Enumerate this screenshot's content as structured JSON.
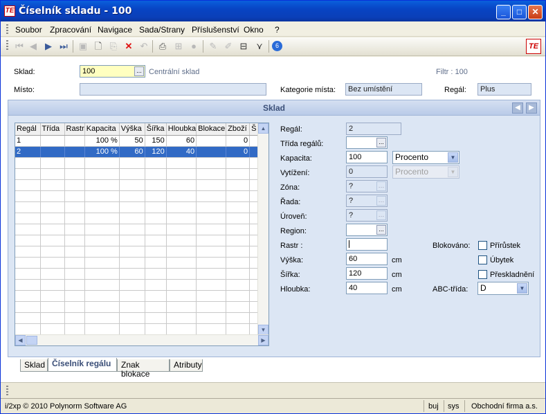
{
  "window": {
    "title": "Číselník skladu - 100",
    "app_logo": "TE"
  },
  "menu": [
    "Soubor",
    "Zpracování",
    "Navigace",
    "Sada/Strany",
    "Příslušenství",
    "Okno",
    "?"
  ],
  "toolbar": {
    "icons": [
      "first-icon",
      "prev-icon",
      "next-icon",
      "last-icon",
      "save-icon",
      "new-icon",
      "copy-icon",
      "delete-icon",
      "undo-icon",
      "print-icon",
      "tree-icon",
      "stop-icon",
      "edit-icon",
      "edit2-icon",
      "export-icon",
      "filter-icon",
      "info-icon"
    ],
    "logo": "TE"
  },
  "header": {
    "sklad_label": "Sklad:",
    "sklad_value": "100",
    "sklad_name": "Centrální sklad",
    "filtr": "Filtr : 100",
    "misto_label": "Místo:",
    "misto_value": "",
    "kategorie_label": "Kategorie místa:",
    "kategorie_value": "Bez umístění",
    "regal_label": "Regál:",
    "regal_value": "Plus"
  },
  "panel": {
    "title": "Sklad"
  },
  "grid": {
    "columns": [
      "Regál",
      "Třída",
      "Rastr",
      "Kapacita",
      "Výška",
      "Šířka",
      "Hloubka",
      "Blokace",
      "Zboží",
      "Š"
    ],
    "rows": [
      [
        "1",
        "",
        "",
        "100 %",
        "50",
        "150",
        "60",
        "",
        "0",
        ""
      ],
      [
        "2",
        "",
        "",
        "100 %",
        "60",
        "120",
        "40",
        "",
        "0",
        ""
      ]
    ],
    "selected_row": 1
  },
  "form": {
    "regal_label": "Regál:",
    "regal_value": "2",
    "trida_label": "Třída regálů:",
    "trida_value": "",
    "kapacita_label": "Kapacita:",
    "kapacita_value": "100",
    "kapacita_unit": "Procento",
    "vytizeni_label": "Vytížení:",
    "vytizeni_value": "0",
    "vytizeni_unit": "Procento",
    "zona_label": "Zóna:",
    "zona_value": "?",
    "rada_label": "Řada:",
    "rada_value": "?",
    "uroven_label": "Úroveň:",
    "uroven_value": "?",
    "region_label": "Region:",
    "region_value": "",
    "rastr_label": "Rastr :",
    "rastr_value": "",
    "vyska_label": "Výška:",
    "vyska_value": "60",
    "vyska_unit": "cm",
    "sirka_label": "Šířka:",
    "sirka_value": "120",
    "sirka_unit": "cm",
    "hloubka_label": "Hloubka:",
    "hloubka_value": "40",
    "hloubka_unit": "cm",
    "blokovano_label": "Blokováno:",
    "prirustek": "Přírůstek",
    "ubytek": "Úbytek",
    "preskladneni": "Přeskladnění",
    "abc_label": "ABC-třída:",
    "abc_value": "D"
  },
  "tabs": [
    "Sklad",
    "Číselník regálu",
    "Znak blokace",
    "Atributy"
  ],
  "status": {
    "copyright": "i/2xp © 2010 Polynorm Software AG",
    "user": "buj",
    "db": "sys",
    "company": "Obchodní firma a.s."
  }
}
